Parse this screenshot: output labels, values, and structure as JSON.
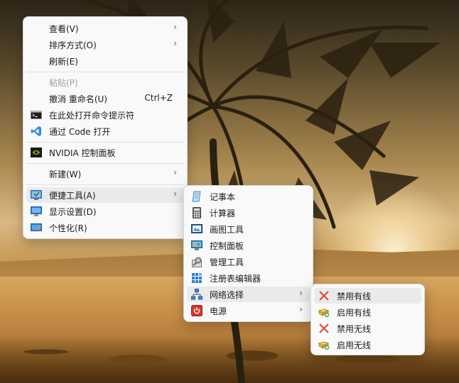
{
  "main_menu": {
    "items": [
      {
        "label": "查看(V)"
      },
      {
        "label": "排序方式(O)"
      },
      {
        "label": "刷新(E)"
      },
      {
        "label": "粘贴(P)"
      },
      {
        "label": "撤消 重命名(U)",
        "shortcut": "Ctrl+Z"
      },
      {
        "label": "在此处打开命令提示符"
      },
      {
        "label": "通过 Code 打开"
      },
      {
        "label": "NVIDIA 控制面板"
      },
      {
        "label": "新建(W)"
      },
      {
        "label": "便捷工具(A)"
      },
      {
        "label": "显示设置(D)"
      },
      {
        "label": "个性化(R)"
      }
    ]
  },
  "tools_menu": {
    "items": [
      {
        "label": "记事本"
      },
      {
        "label": "计算器"
      },
      {
        "label": "画图工具"
      },
      {
        "label": "控制面板"
      },
      {
        "label": "管理工具"
      },
      {
        "label": "注册表编辑器"
      },
      {
        "label": "网络选择"
      },
      {
        "label": "电源"
      }
    ]
  },
  "network_menu": {
    "items": [
      {
        "label": "禁用有线"
      },
      {
        "label": "启用有线"
      },
      {
        "label": "禁用无线"
      },
      {
        "label": "启用无线"
      }
    ]
  },
  "colors": {
    "menu_bg": "#f9f9f9",
    "highlight": "#eaeaea",
    "disabled_text": "#a0a0a0",
    "disable_x": "#d9472b",
    "vscode_blue": "#2a8ce0",
    "nvidia_green": "#76b900"
  }
}
